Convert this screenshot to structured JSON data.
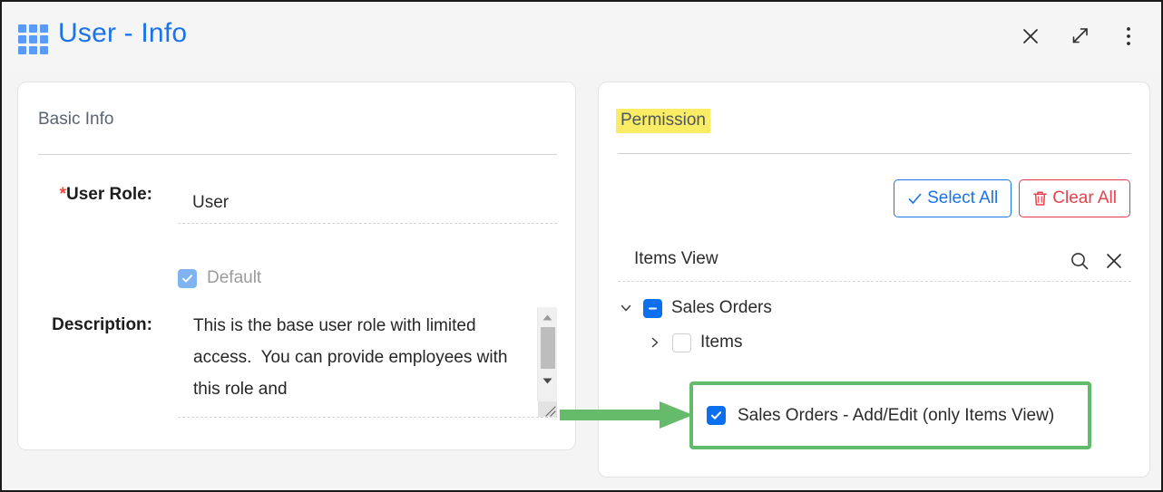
{
  "window": {
    "title": "User - Info",
    "app_icon": "grid-icon",
    "accent_color": "#1a73e8",
    "actions": [
      {
        "name": "close",
        "icon": "close-icon"
      },
      {
        "name": "expand",
        "icon": "expand-diagonal-icon"
      },
      {
        "name": "more",
        "icon": "more-vertical-icon"
      }
    ]
  },
  "basic_info": {
    "section_title": "Basic Info",
    "user_role": {
      "required_marker": "*",
      "label": "User Role:",
      "value": "User",
      "placeholder": ""
    },
    "default_checkbox": {
      "label": "Default",
      "checked": true,
      "disabled": true
    },
    "description": {
      "label": "Description:",
      "value": "This is the base user role with limited access.  You can provide employees with this role and",
      "scrollable": true
    }
  },
  "permission": {
    "section_title": "Permission",
    "highlight_color": "#faec64",
    "select_all_label": "Select All",
    "select_all_icon": "check-icon",
    "clear_all_label": "Clear All",
    "clear_all_icon": "trash-icon",
    "search": {
      "value": "Items View",
      "placeholder": "",
      "search_icon": "search-icon",
      "clear_icon": "close-icon"
    },
    "tree": [
      {
        "label": "Sales Orders",
        "level": 0,
        "expanded": true,
        "twisty": "chevron-down-icon",
        "checkbox_state": "indeterminate"
      },
      {
        "label": "Items",
        "level": 1,
        "expanded": false,
        "twisty": "chevron-right-icon",
        "checkbox_state": "unchecked"
      }
    ],
    "highlighted_item": {
      "label": "Sales Orders - Add/Edit (only Items View)",
      "checkbox_state": "checked",
      "outline_color": "#62bb6a"
    }
  },
  "annotation": {
    "arrow": {
      "name": "callout-arrow",
      "color": "#66bb6a",
      "direction": "right"
    }
  }
}
